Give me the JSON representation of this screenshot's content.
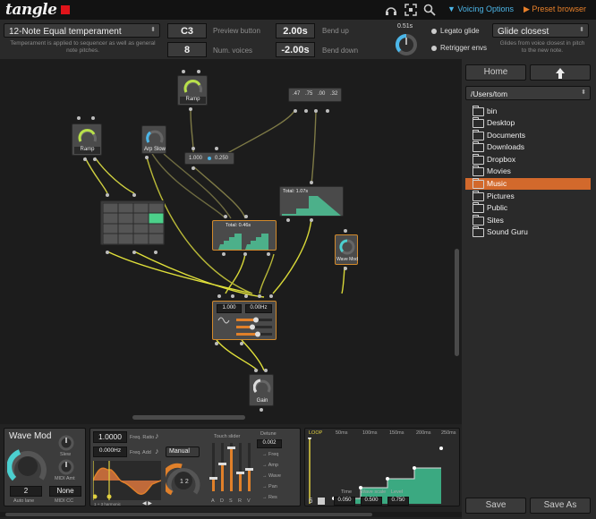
{
  "header": {
    "logo": "tangle",
    "voicing_options": "Voicing Options",
    "preset_browser": "Preset browser",
    "colors": {
      "accent_blue": "#4cb6e8",
      "accent_orange": "#e8802a",
      "logo_red": "#e0141a"
    }
  },
  "toolbar": {
    "temperament": "12-Note Equal temperament",
    "temperament_note": "Temperament is applied to sequencer as well as general note pitches.",
    "preview_value": "C3",
    "preview_label": "Preview button",
    "voices_value": "8",
    "voices_label": "Num. voices",
    "bend_up_value": "2.00s",
    "bend_up_label": "Bend up",
    "bend_down_value": "-2.00s",
    "bend_down_label": "Bend down",
    "knob_value": "0.51s",
    "legato_label": "Legato glide",
    "retrigger_label": "Retrigger envs",
    "glide_mode": "Glide closest",
    "glide_note": "Glides from voice closest in pitch to the new note."
  },
  "canvas": {
    "nodes": {
      "ramp_a": "Ramp",
      "ramp_b": "Ramp",
      "arp_slow": "Arp Slow",
      "wave_mod": "Wave Mod",
      "gain": "Gain",
      "mult_left": "1.000",
      "mult_right": "0.250",
      "const_values": [
        ".47",
        ".75",
        ".00",
        ".32"
      ],
      "env_top_total": "Total:  1.07s",
      "env_mid_total": "Total:  0.46s",
      "osc_value_left": "1.000",
      "osc_value_right": "0.00Hz"
    }
  },
  "sidebar": {
    "home": "Home",
    "path": "/Users/tom",
    "items": [
      "bin",
      "Desktop",
      "Documents",
      "Downloads",
      "Dropbox",
      "Movies",
      "Music",
      "Pictures",
      "Public",
      "Sites",
      "Sound Guru"
    ],
    "selected": "Music",
    "save": "Save",
    "save_as": "Save As"
  },
  "bottom": {
    "module_title": "Wave Mod",
    "slew_label": "Slew",
    "midi_amt_label": "MIDI Amt",
    "auto_lane_value": "2",
    "auto_lane_label": "Auto lane",
    "midi_cc_value": "None",
    "midi_cc_label": "MIDI CC",
    "freq_ratio_value": "1.0000",
    "freq_ratio_label": "Freq. Ratio",
    "freq_add_value": "0.000Hz",
    "freq_add_label": "Freq. Add",
    "harmonic_label": "1 + 3 harmonic",
    "mode_value": "Manual",
    "touch_slider_label": "Touch slider",
    "detune_label": "Detune",
    "detune_value": "0.002",
    "adsr_labels": [
      "A",
      "D",
      "S",
      "R",
      "V"
    ],
    "env_options": [
      "→ Freq",
      "→ Amp",
      "→ Wave",
      "→ Pan",
      "→ Res"
    ],
    "seq_header": [
      "LOOP",
      "50ms",
      "100ms",
      "150ms",
      "200ms",
      "250ms"
    ],
    "seq_time_label": "Time",
    "seq_time_value": "0.050",
    "seq_wave_label": "Wave scale",
    "seq_wave_value": "0.500",
    "seq_level_label": "Level",
    "seq_level_value": "0.750",
    "seq_step_count": "6"
  }
}
